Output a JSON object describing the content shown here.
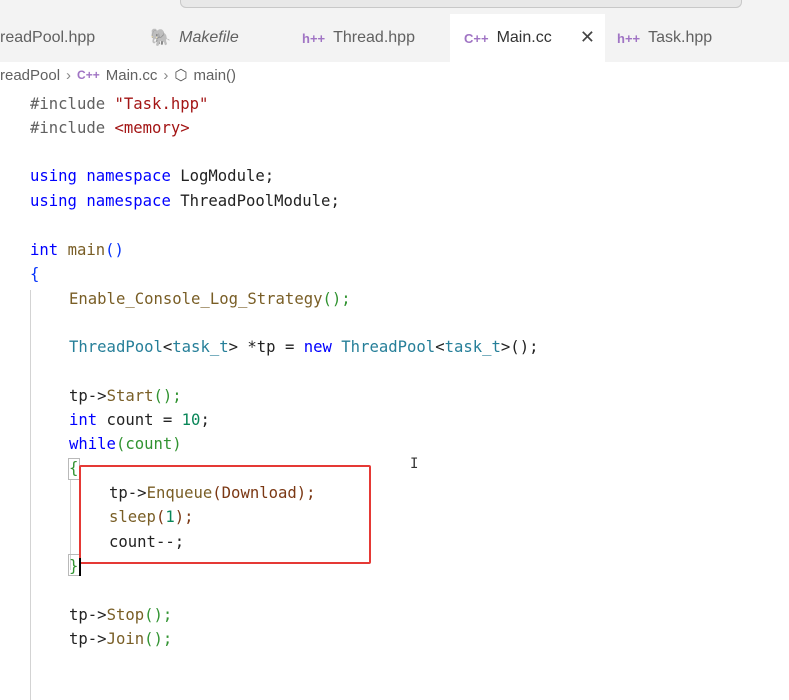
{
  "tabs": [
    {
      "label": "readPool.hpp",
      "icon": "none",
      "active": false,
      "italic": false
    },
    {
      "label": "Makefile",
      "icon": "makefile-icon",
      "active": false,
      "italic": true
    },
    {
      "label": "Thread.hpp",
      "icon": "cpp-header-icon",
      "icon_text": "h++",
      "active": false,
      "italic": false
    },
    {
      "label": "Main.cc",
      "icon": "cpp-icon",
      "icon_text": "C++",
      "active": true,
      "italic": false,
      "close": "✕"
    },
    {
      "label": "Task.hpp",
      "icon": "cpp-header-icon",
      "icon_text": "h++",
      "active": false,
      "italic": false
    }
  ],
  "breadcrumb": {
    "items": [
      "readPool",
      "Main.cc",
      "main()"
    ],
    "separator": "›",
    "file_icon_text": "C++"
  },
  "code": {
    "l1": {
      "pp": "#include",
      "str": "\"Task.hpp\""
    },
    "l2": {
      "pp": "#include",
      "str": "<memory>"
    },
    "l3": {
      "kw1": "using",
      "kw2": "namespace",
      "name": "LogModule;"
    },
    "l4": {
      "kw1": "using",
      "kw2": "namespace",
      "name": "ThreadPoolModule;"
    },
    "l5": {
      "kw": "int",
      "fn": "main",
      "paren": "()"
    },
    "l6": {
      "brace": "{"
    },
    "l7": {
      "fn": "Enable_Console_Log_Strategy",
      "rest": "();"
    },
    "l8": {
      "typ1": "ThreadPool",
      "lt": "<",
      "typ2": "task_t",
      "mid": "> *tp = ",
      "kw": "new",
      "typ3": "ThreadPool",
      "lt2": "<",
      "typ4": "task_t",
      "end": ">();"
    },
    "l9": {
      "obj": "tp->",
      "fn": "Start",
      "rest": "();"
    },
    "l10": {
      "kw": "int",
      "mid": " count = ",
      "num": "10",
      "end": ";"
    },
    "l11": {
      "kw": "while",
      "rest": "(count)"
    },
    "l12": {
      "brace": "{"
    },
    "l13": {
      "obj": "tp->",
      "fn": "Enqueue",
      "rest": "(Download);"
    },
    "l14": {
      "fn": "sleep",
      "open": "(",
      "num": "1",
      "close": ");"
    },
    "l15": {
      "text": "count--;"
    },
    "l16": {
      "brace": "}"
    },
    "l17": {
      "obj": "tp->",
      "fn": "Stop",
      "rest": "();"
    },
    "l18": {
      "obj": "tp->",
      "fn": "Join",
      "rest": "();"
    }
  },
  "colors": {
    "keyword": "#0000ff",
    "string": "#a31515",
    "type": "#267f99",
    "function": "#795e26",
    "number": "#098658",
    "annotation_box": "#e53935"
  },
  "cursor_glyph": "I"
}
